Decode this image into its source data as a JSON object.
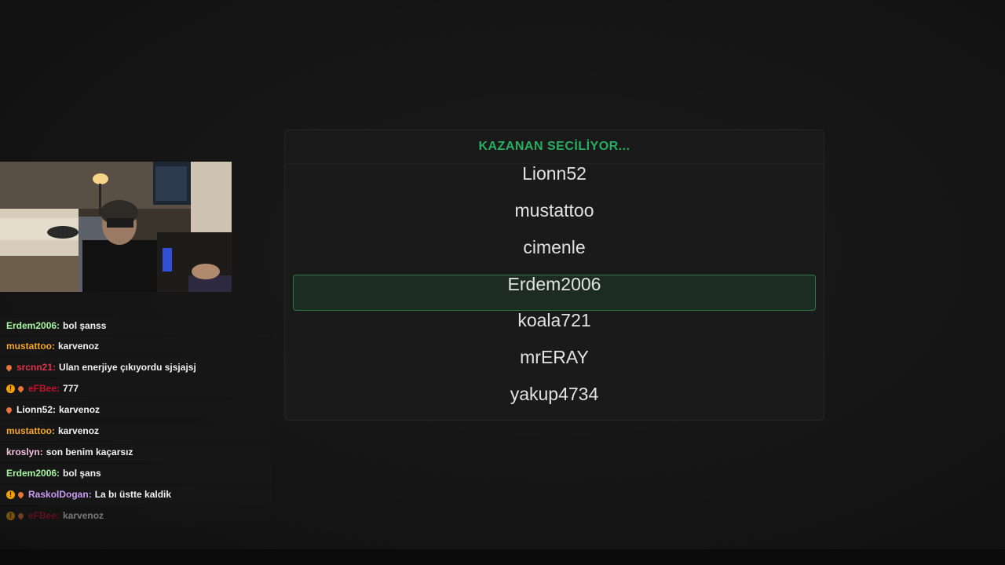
{
  "picker": {
    "title": "KAZANAN SECİLİYOR...",
    "names": [
      "Lionn52",
      "mustattoo",
      "cimenle",
      "Erdem2006",
      "koala721",
      "mrERAY",
      "yakup4734"
    ],
    "highlighted_index": 3,
    "title_color": "#27ae60"
  },
  "chat": {
    "messages": [
      {
        "user": "Erdem2006",
        "text": "bol şanss",
        "user_color": "#a6f5a0",
        "badges": []
      },
      {
        "user": "mustattoo",
        "text": "karvenoz",
        "user_color": "#f5a623",
        "badges": []
      },
      {
        "user": "srcnn21",
        "text": "Ulan enerjiye çıkıyordu sjsjajsj",
        "user_color": "#e0314b",
        "badges": [
          "fire-icon"
        ]
      },
      {
        "user": "eFBee",
        "text": "777",
        "user_color": "#c4102c",
        "badges": [
          "one-icon",
          "fire-icon"
        ]
      },
      {
        "user": "Lionn52",
        "text": "karvenoz",
        "user_color": "#f2f2f2",
        "badges": [
          "fire-icon"
        ]
      },
      {
        "user": "mustattoo",
        "text": "karvenoz",
        "user_color": "#f5a623",
        "badges": []
      },
      {
        "user": "kroslyn",
        "text": "son benim kaçarsız",
        "user_color": "#f3c0e2",
        "badges": []
      },
      {
        "user": "Erdem2006",
        "text": "bol şans",
        "user_color": "#a6f5a0",
        "badges": []
      },
      {
        "user": "RaskolDogan",
        "text": "La bı üstte kaldik",
        "user_color": "#c99cf2",
        "badges": [
          "one-icon",
          "fire-icon"
        ]
      },
      {
        "user": "eFBee",
        "text": "karvenoz",
        "user_color": "#c4102c",
        "badges": [
          "one-icon",
          "fire-icon"
        ]
      }
    ]
  }
}
